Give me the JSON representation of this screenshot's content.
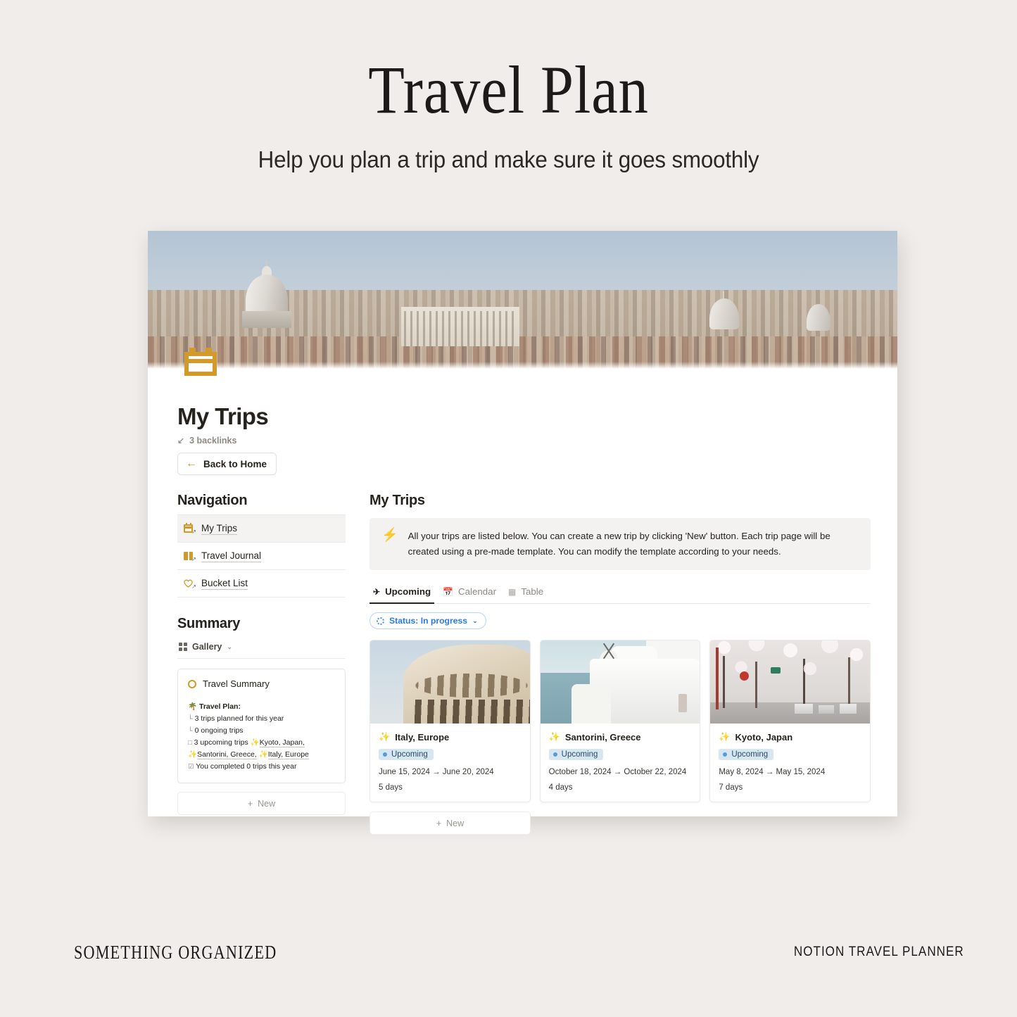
{
  "promo": {
    "title": "Travel Plan",
    "subtitle": "Help you plan a trip and make sure it goes smoothly"
  },
  "footer": {
    "brand": "SOMETHING ORGANIZED",
    "product": "NOTION TRAVEL PLANNER"
  },
  "page": {
    "icon": "calendar-icon",
    "title": "My Trips",
    "backlinks": "3 backlinks",
    "backlinks_icon": "arrow-down-left-icon",
    "back_button": "Back to Home",
    "back_icon": "arrow-left-icon"
  },
  "navigation": {
    "heading": "Navigation",
    "items": [
      {
        "label": "My Trips",
        "icon": "calendar-icon",
        "active": true
      },
      {
        "label": "Travel Journal",
        "icon": "book-icon",
        "active": false
      },
      {
        "label": "Bucket List",
        "icon": "heart-icon",
        "active": false
      }
    ]
  },
  "summary": {
    "heading": "Summary",
    "view": {
      "label": "Gallery",
      "icon": "grid-icon",
      "chevron": "⌄"
    },
    "card": {
      "title": "Travel Summary",
      "status_icon": "circle-icon",
      "plan_label": "Travel Plan:",
      "plan_icon": "🌴",
      "lines": [
        {
          "icon": "└",
          "text": "3 trips planned for this year"
        },
        {
          "icon": "└",
          "text": "0 ongoing trips"
        },
        {
          "icon": "□",
          "text": "3 upcoming trips"
        },
        {
          "icon": "☑",
          "text": "You completed 0 trips this year"
        }
      ],
      "trip_links": [
        "Kyoto, Japan,",
        "Santorini, Greece,",
        "Italy, Europe"
      ]
    },
    "new_button": "New",
    "new_icon": "plus-icon"
  },
  "main": {
    "title": "My Trips",
    "callout": {
      "icon": "bolt-icon",
      "text": "All your trips are listed below. You can create a new trip by clicking 'New' button. Each trip page will be created using a pre-made template. You can modify the template according to your needs."
    },
    "tabs": [
      {
        "label": "Upcoming",
        "icon": "airplane-icon",
        "active": true
      },
      {
        "label": "Calendar",
        "icon": "calendar-view-icon",
        "active": false
      },
      {
        "label": "Table",
        "icon": "table-icon",
        "active": false
      }
    ],
    "filter": {
      "label": "Status: In progress",
      "icon": "spinner-icon",
      "chevron": "⌄"
    },
    "cards": [
      {
        "emoji": "✨",
        "title": "Italy, Europe",
        "status": "Upcoming",
        "dates": "June 15, 2024 → June 20, 2024",
        "duration": "5 days",
        "thumb": "colosseum-photo"
      },
      {
        "emoji": "✨",
        "title": "Santorini, Greece",
        "status": "Upcoming",
        "dates": "October 18, 2024 → October 22, 2024",
        "duration": "4 days",
        "thumb": "santorini-photo"
      },
      {
        "emoji": "✨",
        "title": "Kyoto, Japan",
        "status": "Upcoming",
        "dates": "May 8, 2024 → May 15, 2024",
        "duration": "7 days",
        "thumb": "kyoto-photo"
      }
    ],
    "new_button": "New",
    "new_icon": "plus-icon"
  },
  "colors": {
    "page_background": "#f0edea",
    "accent_orange": "#d19a2b",
    "badge_blue": "#d7e7f2",
    "filter_blue": "#2b7ae4",
    "text_dark": "#26231f"
  }
}
